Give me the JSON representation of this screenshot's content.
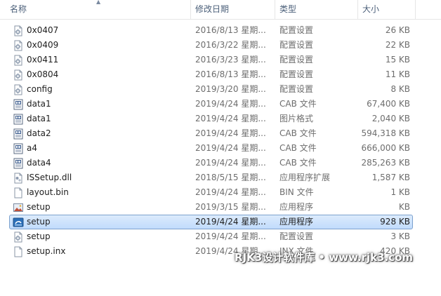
{
  "columns": {
    "name": "名称",
    "date": "修改日期",
    "type": "类型",
    "size": "大小"
  },
  "files": [
    {
      "name": "0x0407",
      "date": "2016/8/13 星期...",
      "type": "配置设置",
      "size": "26 KB",
      "icon": "config-settings-icon"
    },
    {
      "name": "0x0409",
      "date": "2016/3/22 星期...",
      "type": "配置设置",
      "size": "22 KB",
      "icon": "config-settings-icon"
    },
    {
      "name": "0x0411",
      "date": "2016/3/23 星期...",
      "type": "配置设置",
      "size": "15 KB",
      "icon": "config-settings-icon"
    },
    {
      "name": "0x0804",
      "date": "2016/8/13 星期...",
      "type": "配置设置",
      "size": "11 KB",
      "icon": "config-settings-icon"
    },
    {
      "name": "config",
      "date": "2019/3/20 星期...",
      "type": "配置设置",
      "size": "8 KB",
      "icon": "config-settings-icon"
    },
    {
      "name": "data1",
      "date": "2019/4/24 星期...",
      "type": "CAB 文件",
      "size": "67,400 KB",
      "icon": "cab-file-icon"
    },
    {
      "name": "data1",
      "date": "2019/4/24 星期...",
      "type": "图片格式",
      "size": "2,040 KB",
      "icon": "cab-file-icon"
    },
    {
      "name": "data2",
      "date": "2019/4/24 星期...",
      "type": "CAB 文件",
      "size": "594,318 KB",
      "icon": "cab-file-icon"
    },
    {
      "name": "a4",
      "date": "2019/4/24 星期...",
      "type": "CAB 文件",
      "size": "666,000 KB",
      "icon": "cab-file-icon"
    },
    {
      "name": "data4",
      "date": "2019/4/24 星期...",
      "type": "CAB 文件",
      "size": "285,263 KB",
      "icon": "cab-file-icon"
    },
    {
      "name": "ISSetup.dll",
      "date": "2018/5/15 星期...",
      "type": "应用程序扩展",
      "size": "1,587 KB",
      "icon": "dll-file-icon"
    },
    {
      "name": "layout.bin",
      "date": "2019/4/24 星期...",
      "type": "BIN 文件",
      "size": "1 KB",
      "icon": "blank-file-icon"
    },
    {
      "name": "setup",
      "date": "2019/3/15 星期...",
      "type": "应用程序",
      "size": "KB",
      "icon": "setup-image-icon"
    },
    {
      "name": "setup",
      "date": "2019/4/24 星期...",
      "type": "应用程序",
      "size": "928 KB",
      "icon": "setup-app-icon",
      "selected": true
    },
    {
      "name": "setup",
      "date": "2019/4/24 星期...",
      "type": "配置设置",
      "size": "3 KB",
      "icon": "config-settings-icon"
    },
    {
      "name": "setup.inx",
      "date": "2019/4/24 星期...",
      "type": "INX 文件",
      "size": "420 KB",
      "icon": "blank-file-icon"
    }
  ],
  "watermark": "RJK3设计软件库 • www.rjk3.com",
  "colors": {
    "selection_bg": "#c9e0fc",
    "selection_border": "#7da2ce",
    "header_text": "#4c607a",
    "muted_text": "#6d6d6d"
  }
}
